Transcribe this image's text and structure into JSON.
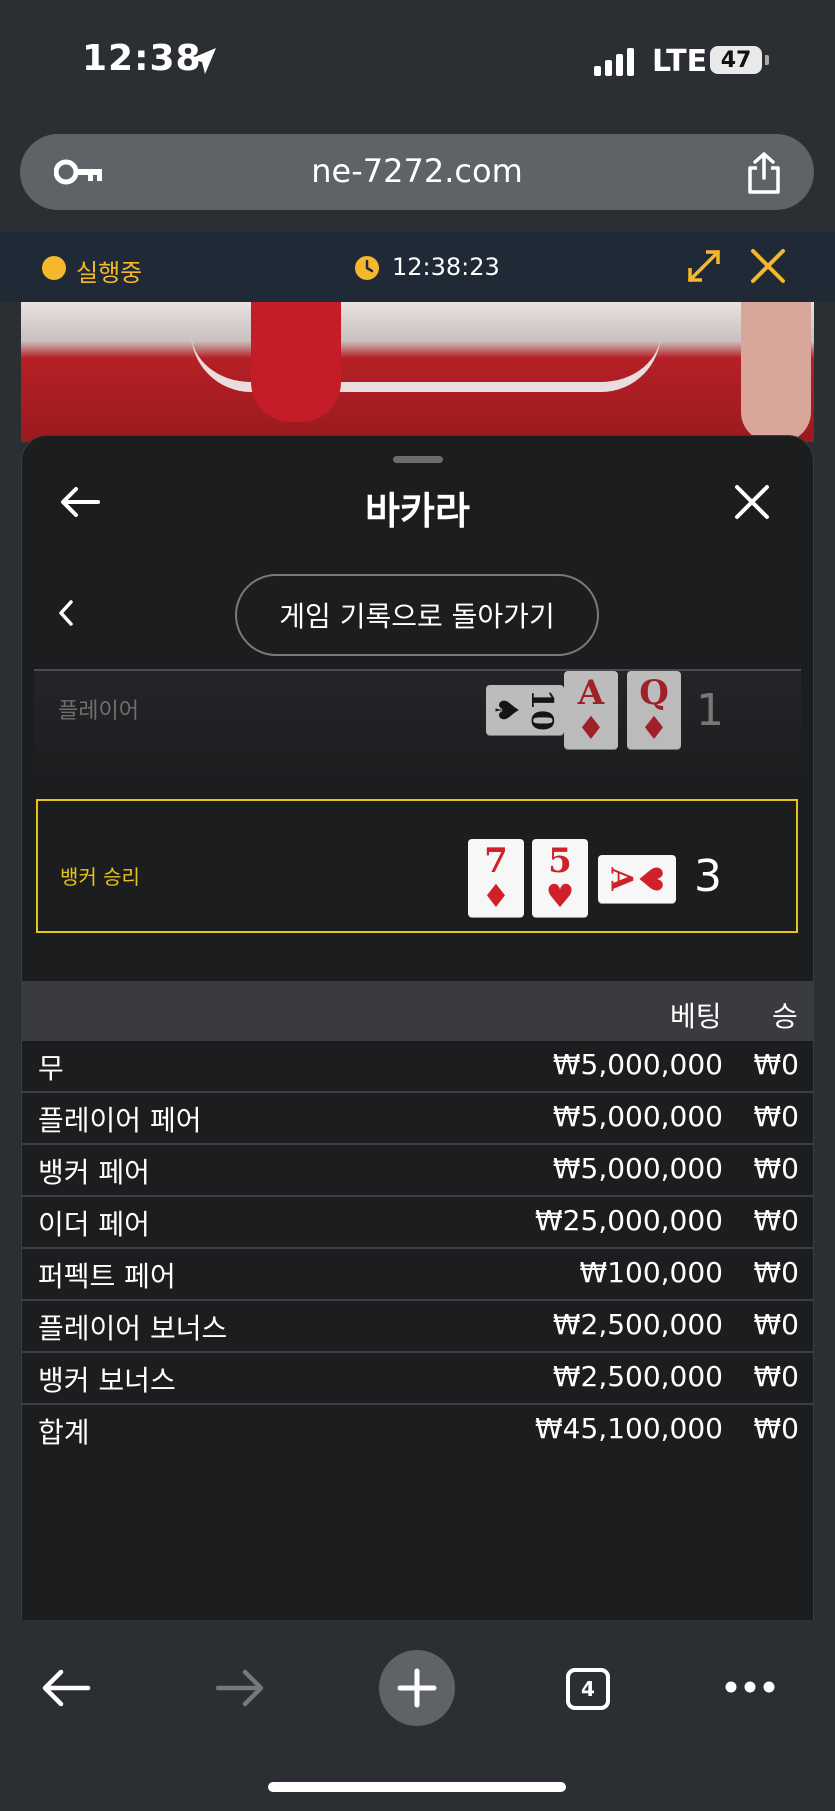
{
  "status_bar": {
    "time": "12:38",
    "network": "LTE",
    "battery": "47"
  },
  "browser": {
    "url": "ne-7272.com",
    "tab_count": "4"
  },
  "game_header": {
    "status": "실행중",
    "clock": "12:38:23"
  },
  "panel": {
    "title": "바카라",
    "history_button": "게임 기록으로 돌아가기"
  },
  "result": {
    "player": {
      "label": "플레이어",
      "score": "1",
      "cards": [
        {
          "rank": "10",
          "suit": "♠",
          "color": "black"
        },
        {
          "rank": "A",
          "suit": "♦",
          "color": "red"
        },
        {
          "rank": "Q",
          "suit": "♦",
          "color": "red"
        }
      ]
    },
    "banker": {
      "label": "뱅커 승리",
      "score": "3",
      "cards": [
        {
          "rank": "7",
          "suit": "♦",
          "color": "red"
        },
        {
          "rank": "5",
          "suit": "♥",
          "color": "red"
        },
        {
          "rank": "A",
          "suit": "♥",
          "color": "red"
        }
      ]
    }
  },
  "bets": {
    "headers": {
      "bet": "베팅",
      "win": "승"
    },
    "rows": [
      {
        "name": "무",
        "bet": "₩5,000,000",
        "win": "₩0"
      },
      {
        "name": "플레이어 페어",
        "bet": "₩5,000,000",
        "win": "₩0"
      },
      {
        "name": "뱅커 페어",
        "bet": "₩5,000,000",
        "win": "₩0"
      },
      {
        "name": "이더 페어",
        "bet": "₩25,000,000",
        "win": "₩0"
      },
      {
        "name": "퍼펙트 페어",
        "bet": "₩100,000",
        "win": "₩0"
      },
      {
        "name": "플레이어 보너스",
        "bet": "₩2,500,000",
        "win": "₩0"
      },
      {
        "name": "뱅커 보너스",
        "bet": "₩2,500,000",
        "win": "₩0"
      },
      {
        "name": "합계",
        "bet": "₩45,100,000",
        "win": "₩0"
      }
    ]
  },
  "colors": {
    "accent": "#f5b72b",
    "banker_highlight": "#e7c419",
    "card_red": "#d0202a"
  }
}
